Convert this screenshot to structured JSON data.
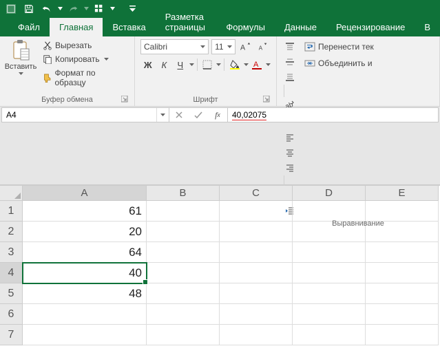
{
  "qat": {
    "save": "save",
    "undo": "undo",
    "redo": "redo",
    "touch": "touch-mouse-mode",
    "customize": "customize"
  },
  "tabs": {
    "file": "Файл",
    "home": "Главная",
    "insert": "Вставка",
    "layout": "Разметка страницы",
    "formulas": "Формулы",
    "data": "Данные",
    "review": "Рецензирование",
    "view_partial": "В"
  },
  "clipboard": {
    "paste": "Вставить",
    "cut": "Вырезать",
    "copy": "Копировать",
    "format_painter": "Формат по образцу",
    "group_label": "Буфер обмена"
  },
  "font": {
    "name": "Calibri",
    "size": "11",
    "group_label": "Шрифт",
    "bold": "Ж",
    "italic": "К",
    "underline": "Ч"
  },
  "alignment": {
    "wrap_partial": "Перенести тек",
    "merge_partial": "Объединить и",
    "group_label": "Выравнивание"
  },
  "namebox": "A4",
  "formula_value": "40,02075",
  "columns": [
    "A",
    "B",
    "C",
    "D",
    "E"
  ],
  "rows": [
    "1",
    "2",
    "3",
    "4",
    "5",
    "6",
    "7"
  ],
  "cells": {
    "A1": "61",
    "A2": "20",
    "A3": "64",
    "A4": "40",
    "A5": "48"
  },
  "selected": "A4"
}
